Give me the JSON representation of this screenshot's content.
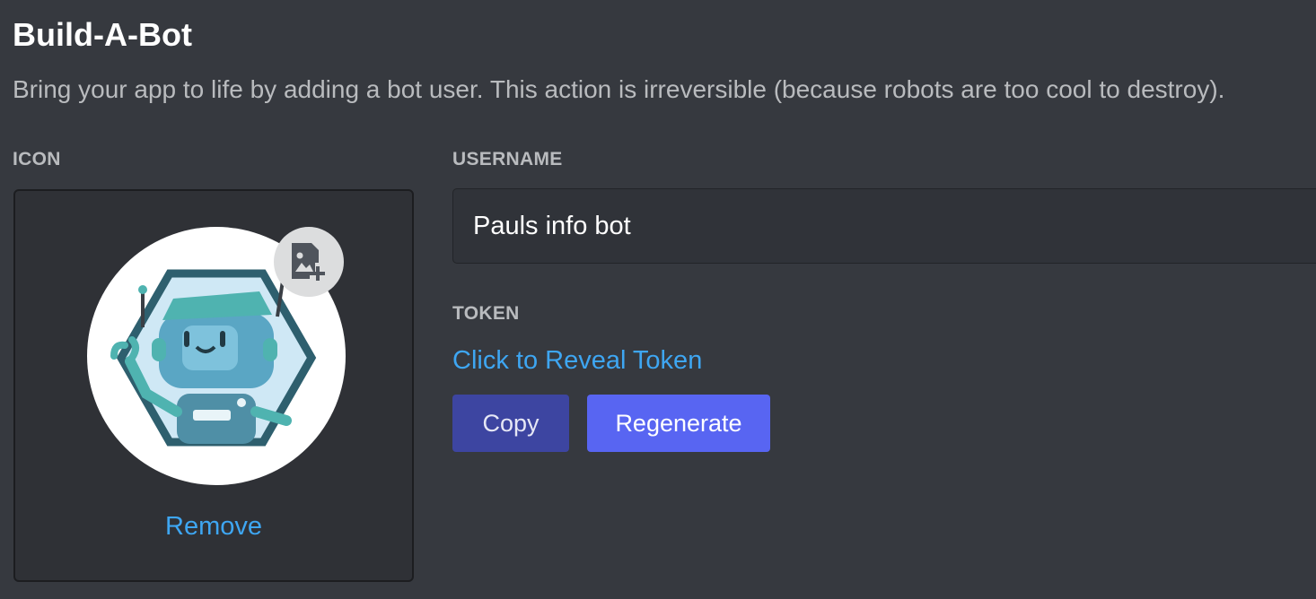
{
  "header": {
    "title": "Build-A-Bot",
    "subtitle": "Bring your app to life by adding a bot user. This action is irreversible (because robots are too cool to destroy)."
  },
  "icon_section": {
    "label": "ICON",
    "avatar_icon": "robot-avatar",
    "upload_icon": "image-add-icon",
    "remove_label": "Remove"
  },
  "username_section": {
    "label": "USERNAME",
    "value": "Pauls info bot"
  },
  "token_section": {
    "label": "TOKEN",
    "reveal_label": "Click to Reveal Token",
    "copy_label": "Copy",
    "regenerate_label": "Regenerate"
  },
  "colors": {
    "background": "#36393f",
    "link": "#3ea6f2",
    "primary_button": "#5865f2",
    "secondary_button": "#3d45a1"
  }
}
